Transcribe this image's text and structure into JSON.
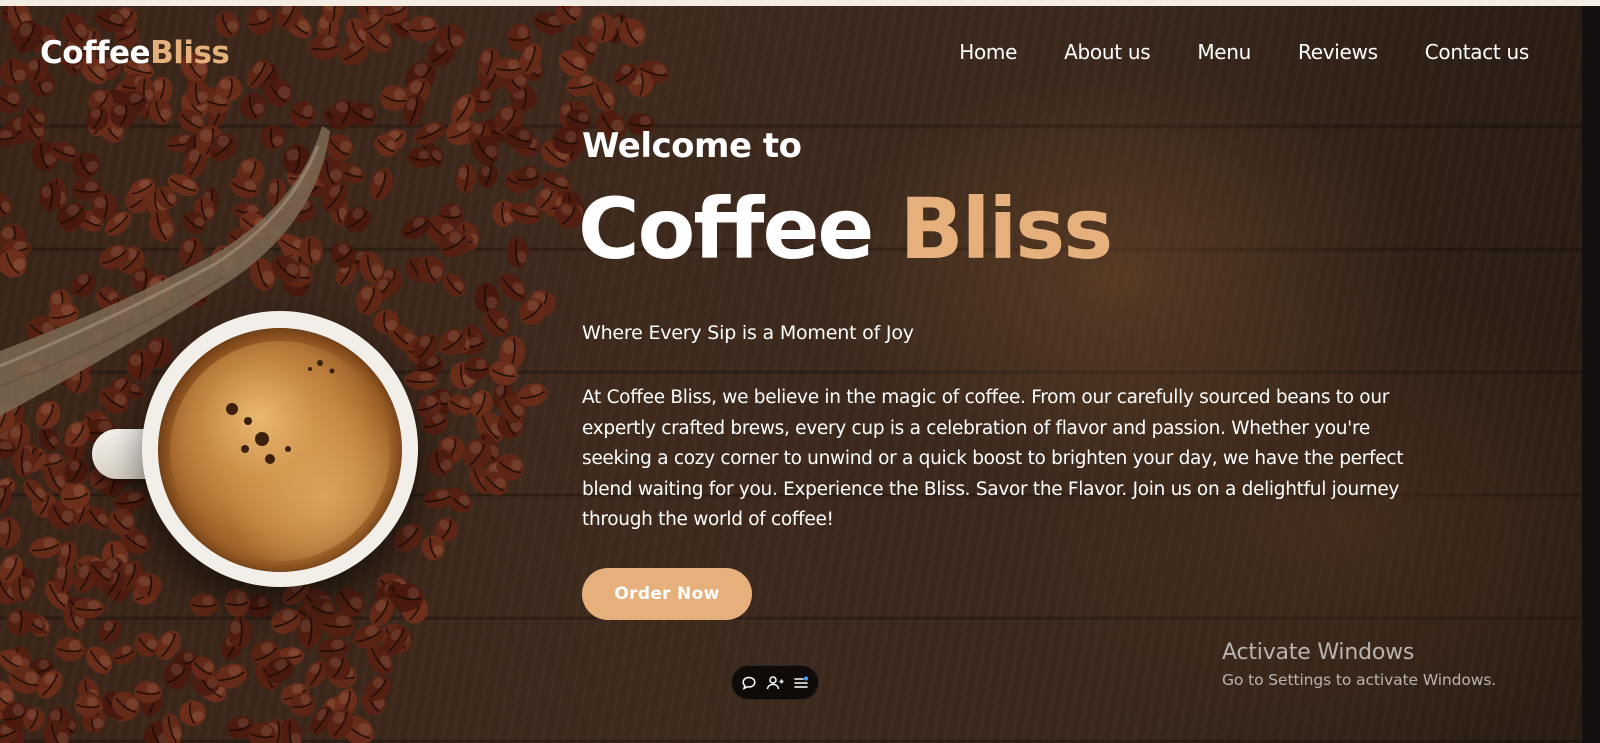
{
  "logo": {
    "part1": "Coffee",
    "part2": "Bliss"
  },
  "nav": {
    "items": [
      "Home",
      "About us",
      "Menu",
      "Reviews",
      "Contact us"
    ]
  },
  "hero": {
    "welcome": "Welcome to",
    "title_part1": "Coffee",
    "title_part2": "Bliss",
    "tagline": "Where Every Sip is a Moment of Joy",
    "description": "At Coffee Bliss, we believe in the magic of coffee. From our carefully sourced beans to our expertly crafted brews, every cup is a celebration of flavor and passion. Whether you're seeking a cozy corner to unwind or a quick boost to brighten your day, we have the perfect blend waiting for you. Experience the Bliss. Savor the Flavor. Join us on a delightful journey through the world of coffee!",
    "cta_label": "Order Now"
  },
  "toolbar": {
    "icons": [
      "chat-icon",
      "add-person-icon",
      "list-icon"
    ]
  },
  "watermark": {
    "title": "Activate Windows",
    "subtitle": "Go to Settings to activate Windows."
  },
  "colors": {
    "accent": "#e6b07c",
    "text": "#ffffff",
    "background": "#3a2518"
  }
}
